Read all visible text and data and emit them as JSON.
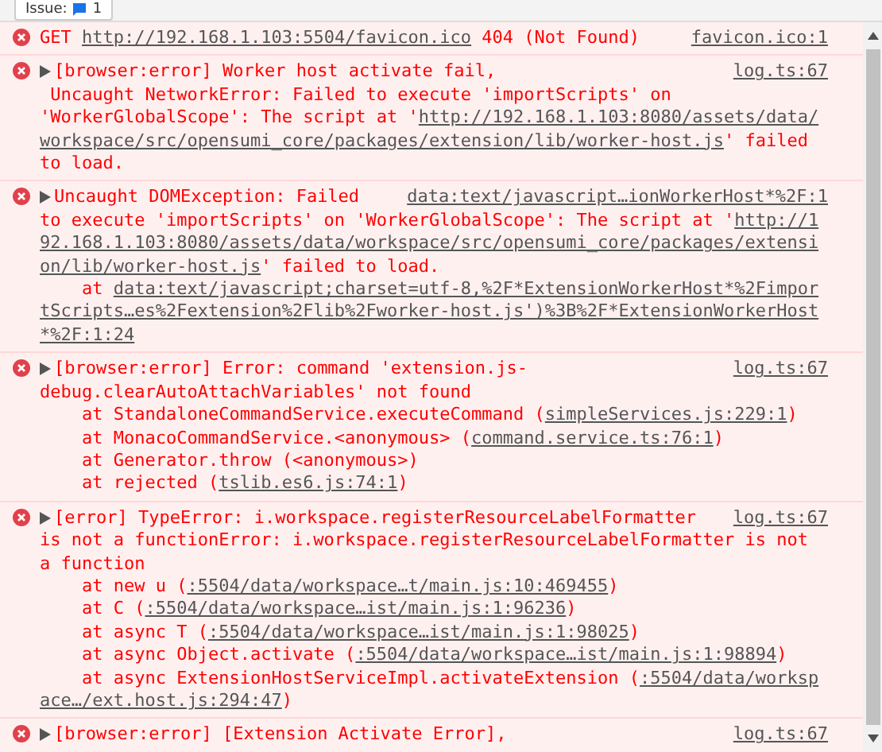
{
  "toolbar": {
    "issues_label": "Issue:",
    "issues_count": "1"
  },
  "messages": [
    {
      "kind": "error",
      "expandable": false,
      "source": "favicon.ico:1",
      "lines": [
        [
          {
            "text": "GET "
          },
          {
            "text": "http://192.168.1.103:5504/favicon.ico",
            "link": true
          },
          {
            "text": " 404 (Not Found)"
          }
        ]
      ]
    },
    {
      "kind": "error",
      "expandable": true,
      "source": "log.ts:67",
      "lines": [
        [
          {
            "text": "[browser:error] Worker host activate fail,"
          }
        ],
        [
          {
            "text": " Uncaught NetworkError: Failed to execute 'importScripts' on"
          }
        ],
        [
          {
            "text": "'WorkerGlobalScope': The script at '"
          },
          {
            "text": "http://192.168.1.103:8080/assets/data/",
            "link": true
          }
        ],
        [
          {
            "text": "workspace/src/opensumi_core/packages/extension/lib/worker-host.js",
            "link": true
          },
          {
            "text": "' failed"
          }
        ],
        [
          {
            "text": "to load."
          }
        ]
      ]
    },
    {
      "kind": "error",
      "expandable": true,
      "source": "data:text/javascript…ionWorkerHost*%2F:1",
      "lines": [
        [
          {
            "text": "Uncaught DOMException: Failed"
          }
        ],
        [
          {
            "text": "to execute 'importScripts' on 'WorkerGlobalScope': The script at '"
          },
          {
            "text": "http://1",
            "link": true
          }
        ],
        [
          {
            "text": "92.168.1.103:8080/assets/data/workspace/src/opensumi_core/packages/extensi",
            "link": true
          }
        ],
        [
          {
            "text": "on/lib/worker-host.js",
            "link": true
          },
          {
            "text": "' failed to load."
          }
        ],
        [
          {
            "text": "    at "
          },
          {
            "text": "data:text/javascript;charset=utf-8,%2F*ExtensionWorkerHost*%2Fimpor",
            "link": true
          }
        ],
        [
          {
            "text": "tScripts…es%2Fextension%2Flib%2Fworker-host.js')%3B%2F*ExtensionWorkerHost",
            "link": true
          }
        ],
        [
          {
            "text": "*%2F:1:24",
            "link": true
          }
        ]
      ]
    },
    {
      "kind": "error",
      "expandable": true,
      "source": "log.ts:67",
      "lines": [
        [
          {
            "text": "[browser:error] Error: command 'extension.js-"
          }
        ],
        [
          {
            "text": "debug.clearAutoAttachVariables' not found"
          }
        ],
        [
          {
            "text": "    at StandaloneCommandService.executeCommand ("
          },
          {
            "text": "simpleServices.js:229:1",
            "link": true
          },
          {
            "text": ")"
          }
        ],
        [
          {
            "text": "    at MonacoCommandService.<anonymous> ("
          },
          {
            "text": "command.service.ts:76:1",
            "link": true
          },
          {
            "text": ")"
          }
        ],
        [
          {
            "text": "    at Generator.throw (<anonymous>)"
          }
        ],
        [
          {
            "text": "    at rejected ("
          },
          {
            "text": "tslib.es6.js:74:1",
            "link": true
          },
          {
            "text": ")"
          }
        ]
      ]
    },
    {
      "kind": "error",
      "expandable": true,
      "source": "log.ts:67",
      "lines": [
        [
          {
            "text": "[error] TypeError: i.workspace.registerResourceLabelFormatter"
          }
        ],
        [
          {
            "text": "is not a functionError: i.workspace.registerResourceLabelFormatter is not"
          }
        ],
        [
          {
            "text": "a function"
          }
        ],
        [
          {
            "text": "    at new u ("
          },
          {
            "text": ":5504/data/workspace…t/main.js:10:469455",
            "link": true
          },
          {
            "text": ")"
          }
        ],
        [
          {
            "text": "    at C ("
          },
          {
            "text": ":5504/data/workspace…ist/main.js:1:96236",
            "link": true
          },
          {
            "text": ")"
          }
        ],
        [
          {
            "text": "    at async T ("
          },
          {
            "text": ":5504/data/workspace…ist/main.js:1:98025",
            "link": true
          },
          {
            "text": ")"
          }
        ],
        [
          {
            "text": "    at async Object.activate ("
          },
          {
            "text": ":5504/data/workspace…ist/main.js:1:98894",
            "link": true
          },
          {
            "text": ")"
          }
        ],
        [
          {
            "text": "    at async ExtensionHostServiceImpl.activateExtension ("
          },
          {
            "text": ":5504/data/worksp",
            "link": true
          }
        ],
        [
          {
            "text": "ace…/ext.host.js:294:47",
            "link": true
          },
          {
            "text": ")"
          }
        ]
      ]
    },
    {
      "kind": "error",
      "expandable": true,
      "source": "log.ts:67",
      "lines": [
        [
          {
            "text": "[browser:error] [Extension Activate Error],"
          }
        ]
      ]
    }
  ]
}
